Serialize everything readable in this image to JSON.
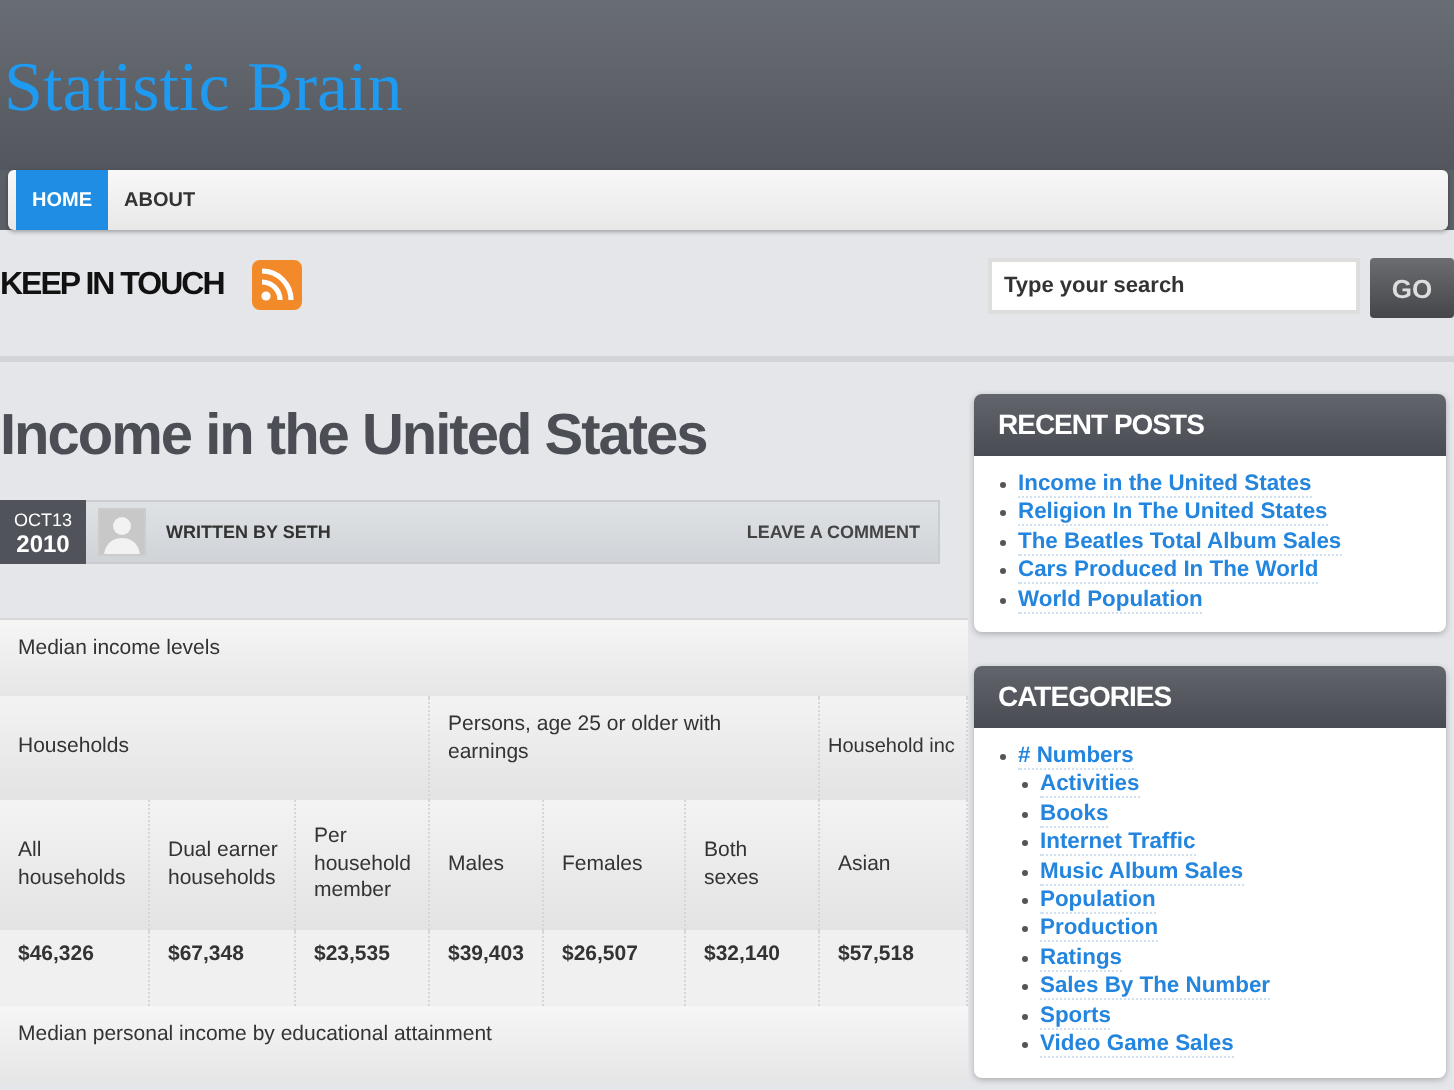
{
  "site": {
    "title": "Statistic Brain"
  },
  "nav": [
    {
      "label": "HOME",
      "selected": true
    },
    {
      "label": "ABOUT",
      "selected": false
    }
  ],
  "social": {
    "label": "KEEP IN TOUCH"
  },
  "search": {
    "placeholder": "Type your search",
    "button": "GO"
  },
  "post": {
    "title": "Income in the United States",
    "date": {
      "month": "OCT",
      "day": "13",
      "year": "2010"
    },
    "byline": "WRITTEN BY SETH",
    "comment_link": "LEAVE A COMMENT"
  },
  "table": {
    "caption": "Median income levels",
    "groups": [
      {
        "label": "Households",
        "columns": [
          "All households",
          "Dual earner households",
          "Per household member"
        ]
      },
      {
        "label": "Persons, age 25 or older with earnings",
        "columns": [
          "Males",
          "Females",
          "Both sexes"
        ]
      },
      {
        "label": "Household inc",
        "columns": [
          "Asian"
        ]
      }
    ],
    "values": [
      "$46,326",
      "$67,348",
      "$23,535",
      "$39,403",
      "$26,507",
      "$32,140",
      "$57,518"
    ],
    "next_caption": "Median personal income by educational attainment"
  },
  "sidebar": {
    "recent_posts": {
      "title": "RECENT POSTS",
      "items": [
        {
          "label": "Income in the United States"
        },
        {
          "label": "Religion In The United States"
        },
        {
          "label": "The Beatles Total Album Sales"
        },
        {
          "label": "Cars Produced In The World"
        },
        {
          "label": "World Population"
        }
      ]
    },
    "categories": {
      "title": "CATEGORIES",
      "items": [
        {
          "label": "# Numbers",
          "children": [
            {
              "label": "Activities"
            },
            {
              "label": "Books"
            },
            {
              "label": "Internet Traffic"
            },
            {
              "label": "Music Album Sales"
            },
            {
              "label": "Population"
            },
            {
              "label": "Production"
            },
            {
              "label": "Ratings"
            },
            {
              "label": "Sales By The Number"
            },
            {
              "label": "Sports"
            },
            {
              "label": "Video Game Sales"
            }
          ]
        }
      ]
    }
  }
}
